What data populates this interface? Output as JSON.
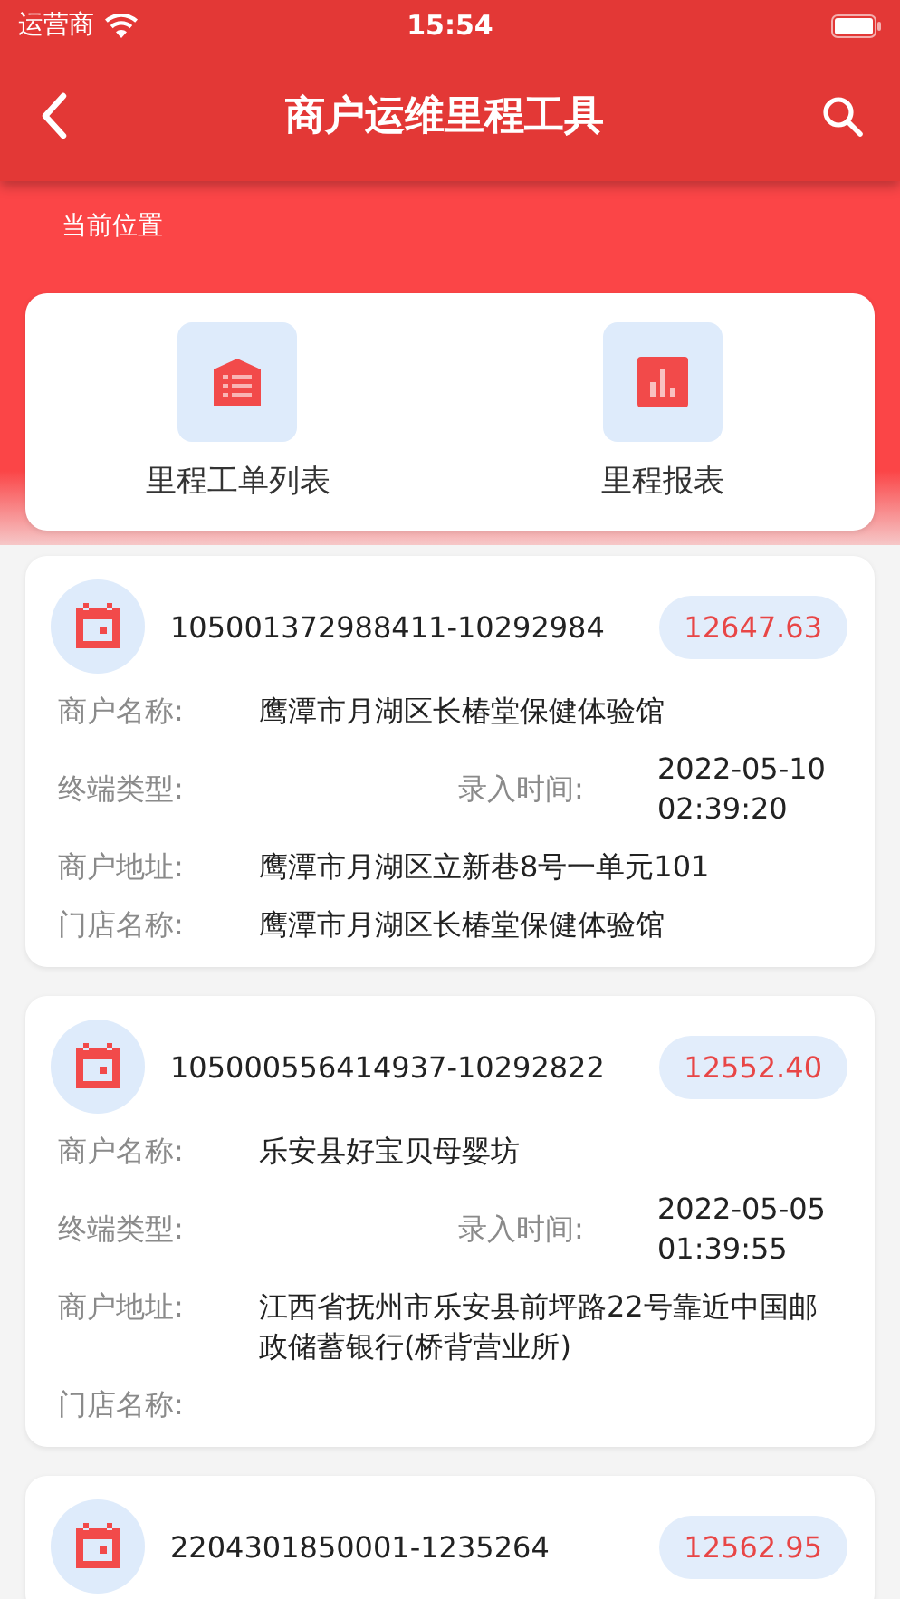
{
  "status_bar": {
    "carrier": "运营商",
    "time": "15:54"
  },
  "nav": {
    "title": "商户运维里程工具"
  },
  "breadcrumb": "当前位置",
  "shortcuts": [
    {
      "label": "里程工单列表",
      "kind": "list"
    },
    {
      "label": "里程报表",
      "kind": "chart"
    }
  ],
  "orders": [
    {
      "id": "105001372988411-10292984",
      "amount": "12647.63",
      "rows": [
        {
          "kind": "single",
          "label": "商户名称:",
          "value": "鹰潭市月湖区长椿堂保健体验馆"
        },
        {
          "kind": "pair",
          "label": "终端类型:",
          "label_2": "录入时间:",
          "value_2": "2022-05-10 02:39:20"
        },
        {
          "kind": "single",
          "label": "商户地址:",
          "value": "鹰潭市月湖区立新巷8号一单元101"
        },
        {
          "kind": "single",
          "label": "门店名称:",
          "value": "鹰潭市月湖区长椿堂保健体验馆"
        }
      ]
    },
    {
      "id": "105000556414937-10292822",
      "amount": "12552.40",
      "rows": [
        {
          "kind": "single",
          "label": "商户名称:",
          "value": "乐安县好宝贝母婴坊"
        },
        {
          "kind": "pair",
          "label": "终端类型:",
          "label_2": "录入时间:",
          "value_2": "2022-05-05 01:39:55"
        },
        {
          "kind": "single",
          "label": "商户地址:",
          "value": "江西省抚州市乐安县前坪路22号靠近中国邮政储蓄银行(桥背营业所)"
        },
        {
          "kind": "single",
          "label": "门店名称:"
        }
      ]
    },
    {
      "id": "2204301850001-1235264",
      "amount": "12562.95"
    }
  ]
}
